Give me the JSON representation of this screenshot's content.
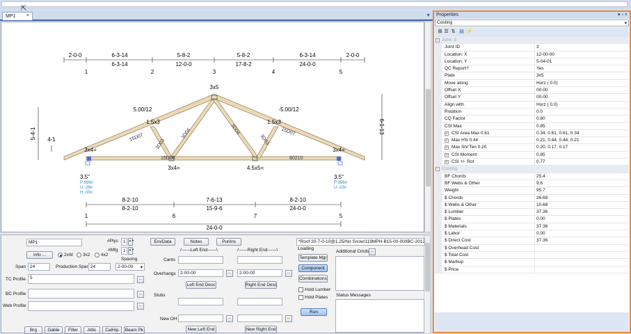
{
  "document_tab": {
    "label": "MP1",
    "close": "×"
  },
  "truss": {
    "top_dims": [
      "2-0-0",
      "6-3-14",
      "5-8-2",
      "5-8-2",
      "6-3-14",
      "2-0-0"
    ],
    "top_cum": [
      "6-3-14",
      "12-0-0",
      "17-8-2",
      "24-0-0"
    ],
    "top_nodes": [
      "1",
      "2",
      "3",
      "4",
      "5"
    ],
    "slope_left": "5.00/12",
    "slope_right": "-5.00/12",
    "plate_top": "3x5",
    "plate_left_mid": "1.5x3",
    "plate_right_mid": "1.5x3",
    "plate_left_heel": "3x4=",
    "plate_right_heel": "3x4=",
    "member_labels": [
      "15D07",
      "3D03",
      "3D04",
      "3D04",
      "3D03",
      "15D07"
    ],
    "bottom_chord_label_left": "15D06",
    "bottom_chord_label_right": "80210",
    "plate_bl": "3x4=",
    "plate_br": "4.5x5=",
    "left_height": "5-4-1",
    "right_height": "6-1-13",
    "overhang": "4-1",
    "bearing_left": "3.5\"",
    "bearing_right": "3.5\"",
    "reactions_left": [
      "P:996#",
      "U:-28#",
      "H:-55#"
    ],
    "reactions_right": [
      "P:996#",
      "U:-23#"
    ],
    "bot_dims": [
      "8-2-10",
      "7-6-13",
      "8-2-10"
    ],
    "bot_cum": [
      "8-2-10",
      "15-9-6",
      "24-0-0"
    ],
    "bot_nodes": [
      "1",
      "6",
      "7",
      "5"
    ],
    "overall": "24-0-0"
  },
  "panel": {
    "name": "MP1",
    "plys_label": "#Plys",
    "plys": "1",
    "mfg_label": "#Mfg",
    "mfg": "1",
    "info_btn": "Info ...",
    "radio_2xw": "2xW",
    "radio_3x2": "3x2",
    "radio_4x2": "4x2",
    "spacing_label": "Spacing",
    "spacing": "2-00-00",
    "span_label": "Span",
    "span": "24",
    "prod_span_label": "Production Span",
    "prod_span": "24",
    "tc_label": "TC Profile",
    "tc_value": "5",
    "bc_label": "BC Profile",
    "web_label": "Web Profile",
    "btns_bottom": [
      "Brg",
      "Gable",
      "Filler",
      "Attic",
      "CalHip",
      "Beam Pk"
    ],
    "envdata": "EnvData",
    "notes": "Notes",
    "purlins": "Purlins",
    "left_end": "/------Left End------\\",
    "right_end": "/------Right End------\\",
    "cants": "Cants",
    "overhangs": "Overhangs",
    "overhang_left": "2-00-00",
    "overhang_right": "2-00-00",
    "left_end_desc": "Left End Desc",
    "right_end_desc": "Right End Desc",
    "stubs": "Stubs",
    "new_oh": "New OH",
    "new_left_end": "New Left End",
    "new_right_end": "New Right End",
    "desc": "*Roof 20-7-0-10@1.25/No Snow/119MPH-B15-00-00/IBC-2012/ASCE",
    "loading": "Loading",
    "template_mgr": "Template Mgr",
    "component": "Component",
    "combinations": "Combinations",
    "hold_lumber": "Hold Lumber",
    "hold_plates": "Hold Plates",
    "run": "Run",
    "additional_cmds": "Additional Cmds",
    "status_messages": "Status Messages"
  },
  "properties": {
    "title": "Properties",
    "controls": "▾ ▫ ×",
    "selected": "Costing",
    "rows": [
      {
        "t": "cat",
        "k": "Joint: 3",
        "v": ""
      },
      {
        "k": "Joint ID",
        "v": "3"
      },
      {
        "k": "Location: X",
        "v": "12-00-00"
      },
      {
        "k": "Location: Y",
        "v": "5-04-01"
      },
      {
        "k": "QC Report?",
        "v": "Yes"
      },
      {
        "k": "Plate",
        "v": "3x5"
      },
      {
        "k": "Move along",
        "v": "Horz  ( 0.0)"
      },
      {
        "k": "Offset X",
        "v": "00-00"
      },
      {
        "k": "Offset Y",
        "v": "00-00"
      },
      {
        "k": "Align with",
        "v": "Horz  ( 0.0)"
      },
      {
        "k": "Rotation",
        "v": "0.0"
      },
      {
        "k": "CQ Factor",
        "v": "0.80"
      },
      {
        "k": "CSI Max",
        "v": "0.85"
      },
      {
        "t": "sub",
        "k": "CSI Area Max  0.61",
        "v": "0.34,  0.61,  0.61,  0.34"
      },
      {
        "t": "sub",
        "k": "Max H'b  0.44",
        "v": "0.21,  0.44,  0.44,  0.21"
      },
      {
        "t": "sub",
        "k": "Max Shr'Ten  0.20",
        "v": "0.20,  0.17,  0.17"
      },
      {
        "t": "sub",
        "k": "CSI Moment",
        "v": "0.85"
      },
      {
        "t": "sub",
        "k": "CSI +/- Rot",
        "v": "0.77"
      },
      {
        "t": "cat",
        "k": "Costing",
        "v": ""
      },
      {
        "k": "BF Chords",
        "v": "25.4"
      },
      {
        "k": "BF Webs & Other",
        "v": "9.6"
      },
      {
        "k": "Weight",
        "v": "95.7"
      },
      {
        "k": "$ Chords",
        "v": "26.68"
      },
      {
        "k": "$ Webs & Other",
        "v": "10.68"
      },
      {
        "k": "$ Lumber",
        "v": "37.36"
      },
      {
        "k": "$ Plates",
        "v": "0.00"
      },
      {
        "k": "$ Materials",
        "v": "37.36"
      },
      {
        "k": "$ Labor",
        "v": "0.00"
      },
      {
        "k": "$ Direct Cost",
        "v": "37.36"
      },
      {
        "k": "$ Overhead Cost",
        "v": ""
      },
      {
        "k": "$ Total Cost",
        "v": ""
      },
      {
        "k": "$ Markup",
        "v": ""
      },
      {
        "k": "$ Price",
        "v": ""
      }
    ]
  }
}
